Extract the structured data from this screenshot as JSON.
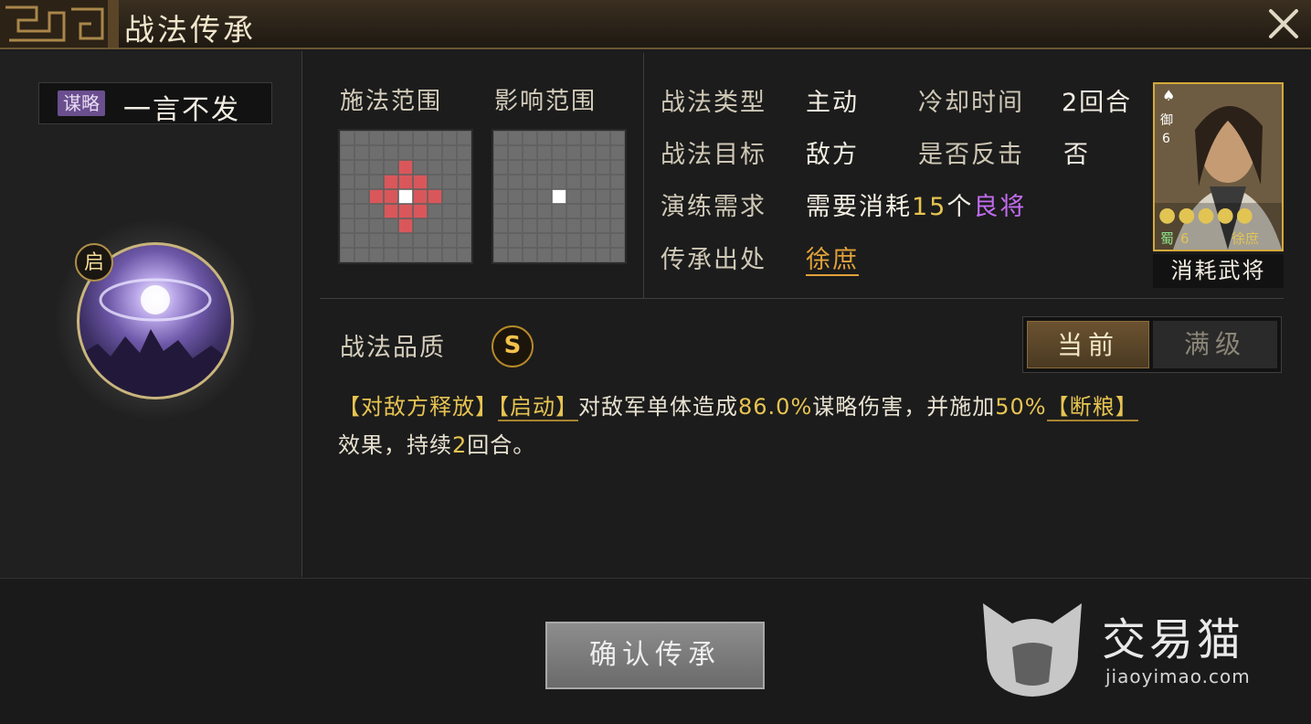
{
  "title": "战法传承",
  "skill": {
    "type_tag": "谋略",
    "name": "一言不发",
    "activation_badge": "启"
  },
  "ranges": {
    "cast_label": "施法范围",
    "effect_label": "影响范围"
  },
  "info": {
    "type_label": "战法类型",
    "type_value": "主动",
    "cooldown_label": "冷却时间",
    "cooldown_value": "2回合",
    "target_label": "战法目标",
    "target_value": "敌方",
    "counter_label": "是否反击",
    "counter_value": "否",
    "train_label": "演练需求",
    "train_prefix": "需要消耗",
    "train_count": "15",
    "train_unit": "个",
    "train_item": "良将",
    "source_label": "传承出处",
    "source_value": "徐庶"
  },
  "card": {
    "suit": "♠",
    "cost_label": "御",
    "cost": "6",
    "stars": "●●●●●",
    "faction": "蜀",
    "level": "6",
    "name": "徐庶",
    "footer": "消耗武将"
  },
  "quality": {
    "label": "战法品质",
    "grade": "S"
  },
  "toggle": {
    "current": "当前",
    "max": "满级"
  },
  "description": {
    "p1": "【对敌方释放】",
    "p2": "【启动】",
    "p3": "对敌军单体造成",
    "p4": "86.0%",
    "p5": "谋略伤害，并施加",
    "p6": "50%",
    "p7": "【断粮】",
    "p8": "效果，持续",
    "p9": "2",
    "p10": "回合。"
  },
  "confirm_button": "确认传承",
  "watermark": {
    "brand": "交易猫",
    "url": "jiaoyimao.com"
  },
  "colors": {
    "highlight": "#e7c451",
    "purple": "#c36cf0",
    "cast_cell": "#d9575a",
    "center_cell": "#ffffff"
  }
}
